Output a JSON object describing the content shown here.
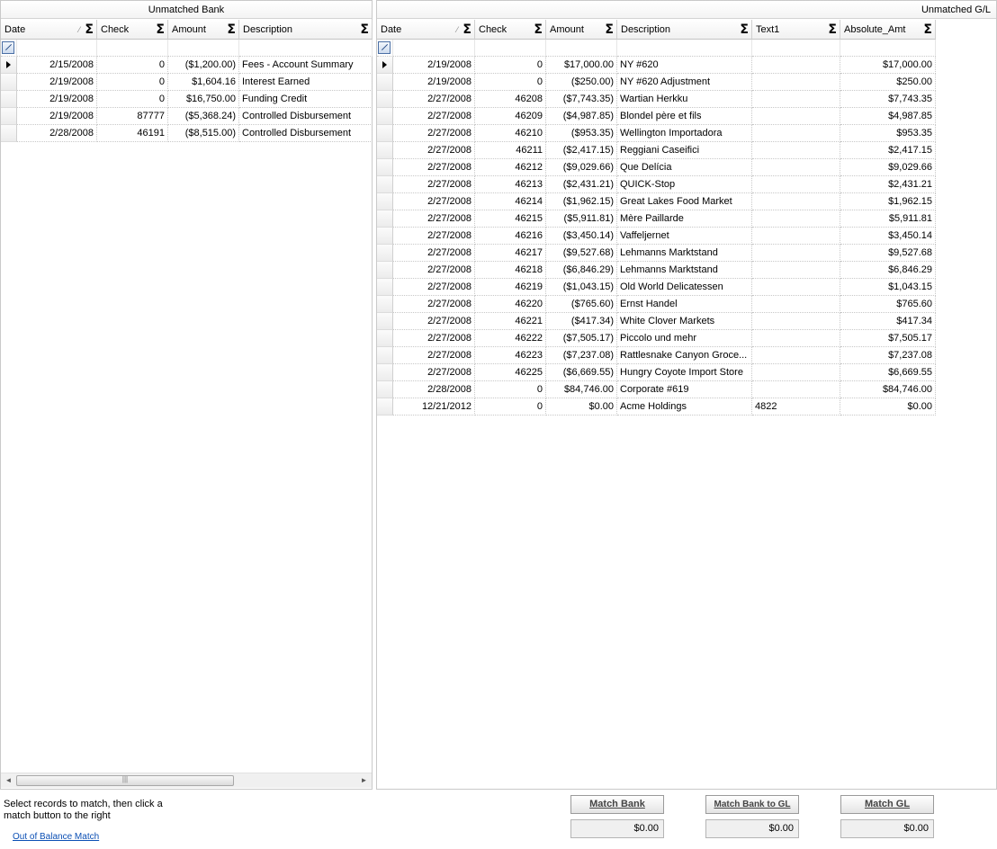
{
  "bank": {
    "caption": "Unmatched Bank",
    "headers": [
      "Date",
      "Check",
      "Amount",
      "Description"
    ],
    "rows": [
      [
        "2/15/2008",
        "0",
        "($1,200.00)",
        "Fees - Account Summary"
      ],
      [
        "2/19/2008",
        "0",
        "$1,604.16",
        "Interest Earned"
      ],
      [
        "2/19/2008",
        "0",
        "$16,750.00",
        "Funding Credit"
      ],
      [
        "2/19/2008",
        "87777",
        "($5,368.24)",
        "Controlled Disbursement"
      ],
      [
        "2/28/2008",
        "46191",
        "($8,515.00)",
        "Controlled Disbursement"
      ]
    ]
  },
  "gl": {
    "caption": "Unmatched G/L",
    "headers": [
      "Date",
      "Check",
      "Amount",
      "Description",
      "Text1",
      "Absolute_Amt"
    ],
    "rows": [
      [
        "2/19/2008",
        "0",
        "$17,000.00",
        "NY #620",
        "",
        "$17,000.00"
      ],
      [
        "2/19/2008",
        "0",
        "($250.00)",
        "NY #620 Adjustment",
        "",
        "$250.00"
      ],
      [
        "2/27/2008",
        "46208",
        "($7,743.35)",
        "Wartian Herkku",
        "",
        "$7,743.35"
      ],
      [
        "2/27/2008",
        "46209",
        "($4,987.85)",
        "Blondel père et fils",
        "",
        "$4,987.85"
      ],
      [
        "2/27/2008",
        "46210",
        "($953.35)",
        "Wellington Importadora",
        "",
        "$953.35"
      ],
      [
        "2/27/2008",
        "46211",
        "($2,417.15)",
        "Reggiani Caseifici",
        "",
        "$2,417.15"
      ],
      [
        "2/27/2008",
        "46212",
        "($9,029.66)",
        "Que Delícia",
        "",
        "$9,029.66"
      ],
      [
        "2/27/2008",
        "46213",
        "($2,431.21)",
        "QUICK-Stop",
        "",
        "$2,431.21"
      ],
      [
        "2/27/2008",
        "46214",
        "($1,962.15)",
        "Great Lakes Food Market",
        "",
        "$1,962.15"
      ],
      [
        "2/27/2008",
        "46215",
        "($5,911.81)",
        "Mère Paillarde",
        "",
        "$5,911.81"
      ],
      [
        "2/27/2008",
        "46216",
        "($3,450.14)",
        "Vaffeljernet",
        "",
        "$3,450.14"
      ],
      [
        "2/27/2008",
        "46217",
        "($9,527.68)",
        "Lehmanns Marktstand",
        "",
        "$9,527.68"
      ],
      [
        "2/27/2008",
        "46218",
        "($6,846.29)",
        "Lehmanns Marktstand",
        "",
        "$6,846.29"
      ],
      [
        "2/27/2008",
        "46219",
        "($1,043.15)",
        "Old World Delicatessen",
        "",
        "$1,043.15"
      ],
      [
        "2/27/2008",
        "46220",
        "($765.60)",
        "Ernst Handel",
        "",
        "$765.60"
      ],
      [
        "2/27/2008",
        "46221",
        "($417.34)",
        "White Clover Markets",
        "",
        "$417.34"
      ],
      [
        "2/27/2008",
        "46222",
        "($7,505.17)",
        "Piccolo und mehr",
        "",
        "$7,505.17"
      ],
      [
        "2/27/2008",
        "46223",
        "($7,237.08)",
        "Rattlesnake Canyon Groce...",
        "",
        "$7,237.08"
      ],
      [
        "2/27/2008",
        "46225",
        "($6,669.55)",
        "Hungry Coyote Import Store",
        "",
        "$6,669.55"
      ],
      [
        "2/28/2008",
        "0",
        "$84,746.00",
        "Corporate #619",
        "",
        "$84,746.00"
      ],
      [
        "12/21/2012",
        "0",
        "$0.00",
        "Acme Holdings",
        "4822",
        "$0.00"
      ]
    ]
  },
  "footer": {
    "instructions": "Select records to match, then click a match button to the right",
    "out_of_balance_label": "Out of Balance Match",
    "match_bank_label": "Match Bank",
    "match_bank_to_gl_label": "Match Bank to GL",
    "match_gl_label": "Match GL",
    "match_bank_total": "$0.00",
    "match_bank_to_gl_total": "$0.00",
    "match_gl_total": "$0.00"
  },
  "icons": {
    "sum": "sigma-icon",
    "filter": "filter-row-icon",
    "current_row": "row-pointer-icon",
    "scroll_grip": "|||"
  }
}
